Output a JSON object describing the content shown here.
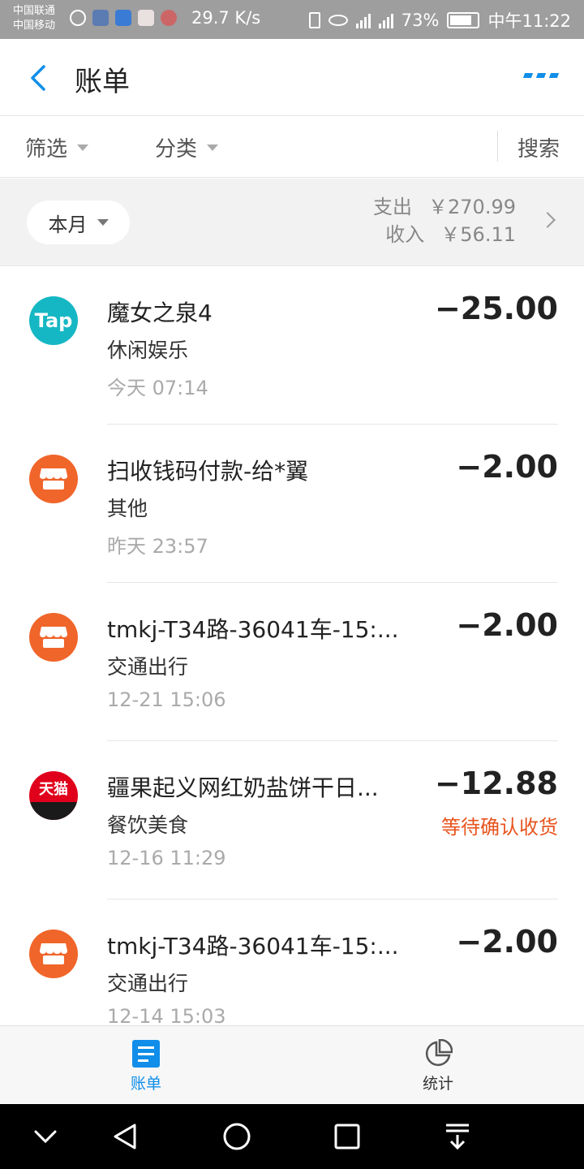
{
  "status_bar": {
    "carrier1": "中国联通",
    "carrier2": "中国移动",
    "net_speed": "29.7 K/s",
    "battery": "73%",
    "time": "中午11:22"
  },
  "nav": {
    "title": "账单",
    "accent_color": "#108ee9"
  },
  "filters": {
    "filter_label": "筛选",
    "category_label": "分类",
    "search_label": "搜索"
  },
  "month": {
    "selector_label": "本月",
    "expense_label": "支出",
    "expense_amount": "￥270.99",
    "income_label": "收入",
    "income_amount": "￥56.11"
  },
  "transactions": [
    {
      "title": "魔女之泉4",
      "category": "休闲娱乐",
      "time": "今天  07:14",
      "amount": "−25.00",
      "status": "",
      "icon": "tap-icon"
    },
    {
      "title": "扫收钱码付款-给*翼",
      "category": "其他",
      "time": "昨天  23:57",
      "amount": "−2.00",
      "status": "",
      "icon": "shop-icon"
    },
    {
      "title": "tmkj-T34路-36041车-15:...",
      "category": "交通出行",
      "time": "12-21  15:06",
      "amount": "−2.00",
      "status": "",
      "icon": "shop-icon"
    },
    {
      "title": "疆果起义网红奶盐饼干日...",
      "category": "餐饮美食",
      "time": "12-16  11:29",
      "amount": "−12.88",
      "status": "等待确认收货",
      "icon": "tmall-icon"
    },
    {
      "title": "tmkj-T34路-36041车-15:...",
      "category": "交通出行",
      "time": "12-14  15:03",
      "amount": "−2.00",
      "status": "",
      "icon": "shop-icon"
    }
  ],
  "tabbar": {
    "bill_label": "账单",
    "stats_label": "统计"
  },
  "icon_text": {
    "tap": "Tap",
    "tmall": "天猫"
  }
}
